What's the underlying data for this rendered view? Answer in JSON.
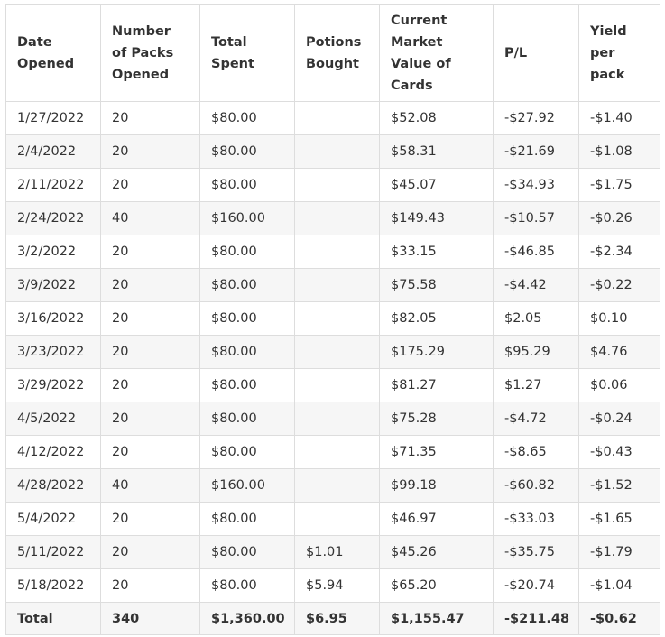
{
  "table": {
    "headers": [
      "Date Opened",
      "Number of Packs Opened",
      "Total Spent",
      "Potions Bought",
      "Current Market Value of Cards",
      "P/L",
      "Yield per pack"
    ],
    "rows": [
      [
        "1/27/2022",
        "20",
        "$80.00",
        "",
        "$52.08",
        "-$27.92",
        "-$1.40"
      ],
      [
        "2/4/2022",
        "20",
        "$80.00",
        "",
        "$58.31",
        "-$21.69",
        "-$1.08"
      ],
      [
        "2/11/2022",
        "20",
        "$80.00",
        "",
        "$45.07",
        "-$34.93",
        "-$1.75"
      ],
      [
        "2/24/2022",
        "40",
        "$160.00",
        "",
        "$149.43",
        "-$10.57",
        "-$0.26"
      ],
      [
        "3/2/2022",
        "20",
        "$80.00",
        "",
        "$33.15",
        "-$46.85",
        "-$2.34"
      ],
      [
        "3/9/2022",
        "20",
        "$80.00",
        "",
        "$75.58",
        "-$4.42",
        "-$0.22"
      ],
      [
        "3/16/2022",
        "20",
        "$80.00",
        "",
        "$82.05",
        "$2.05",
        "$0.10"
      ],
      [
        "3/23/2022",
        "20",
        "$80.00",
        "",
        "$175.29",
        "$95.29",
        "$4.76"
      ],
      [
        "3/29/2022",
        "20",
        "$80.00",
        "",
        "$81.27",
        "$1.27",
        "$0.06"
      ],
      [
        "4/5/2022",
        "20",
        "$80.00",
        "",
        "$75.28",
        "-$4.72",
        "-$0.24"
      ],
      [
        "4/12/2022",
        "20",
        "$80.00",
        "",
        "$71.35",
        "-$8.65",
        "-$0.43"
      ],
      [
        "4/28/2022",
        "40",
        "$160.00",
        "",
        "$99.18",
        "-$60.82",
        "-$1.52"
      ],
      [
        "5/4/2022",
        "20",
        "$80.00",
        "",
        "$46.97",
        "-$33.03",
        "-$1.65"
      ],
      [
        "5/11/2022",
        "20",
        "$80.00",
        "$1.01",
        "$45.26",
        "-$35.75",
        "-$1.79"
      ],
      [
        "5/18/2022",
        "20",
        "$80.00",
        "$5.94",
        "$65.20",
        "-$20.74",
        "-$1.04"
      ]
    ],
    "total": [
      "Total",
      "340",
      "$1,360.00",
      "$6.95",
      "$1,155.47",
      "-$211.48",
      "-$0.62"
    ]
  }
}
